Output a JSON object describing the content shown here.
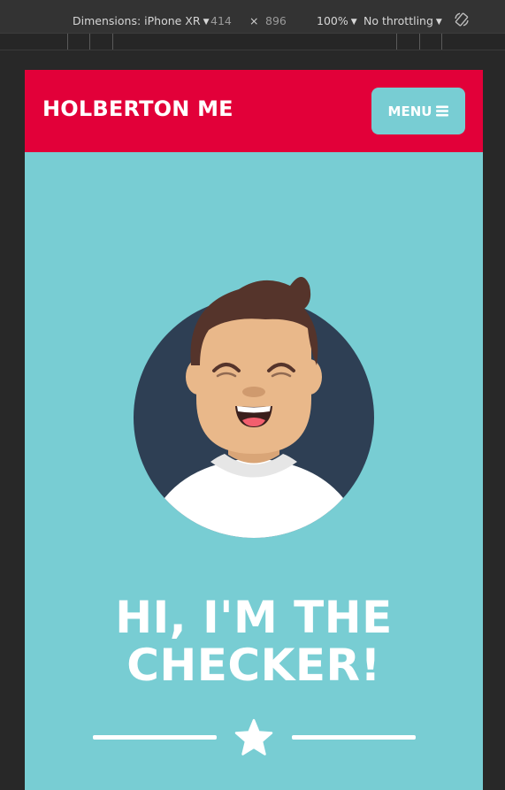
{
  "devtools": {
    "device_label": "Dimensions: iPhone XR",
    "width": "414",
    "times": "×",
    "height": "896",
    "zoom": "100%",
    "throttling": "No throttling",
    "rotate_icon": "rotate-device-icon"
  },
  "site": {
    "brand": "HOLBERTON ME",
    "menu_label": "MENU",
    "menu_icon": "hamburger-icon",
    "headline_line1": "HI, I'M THE",
    "headline_line2": "CHECKER!",
    "divider_icon": "star-icon"
  },
  "colors": {
    "header_red": "#e20039",
    "teal": "#78cdd3",
    "avatar_bg": "#2e3f54",
    "hair": "#55342b",
    "skin": "#e9b88a"
  }
}
